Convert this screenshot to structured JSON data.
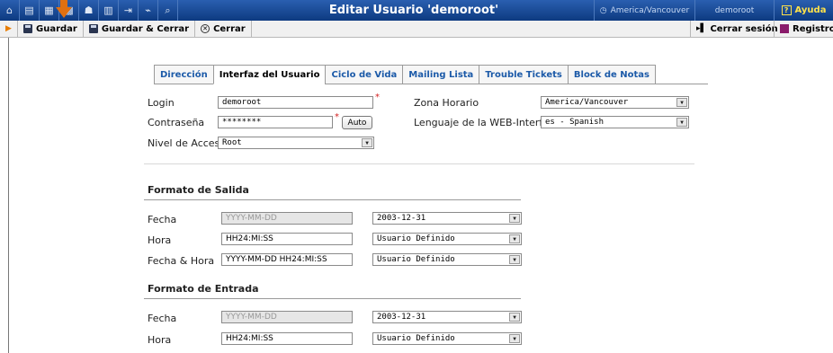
{
  "header": {
    "title": "Editar Usuario 'demoroot'",
    "timezone": "America/Vancouver",
    "user": "demoroot",
    "help_label": "Ayuda",
    "accent_color": "#0d3a80",
    "icons": [
      "home-icon",
      "menu-icon",
      "grid-icon",
      "modules-icon",
      "person-icon",
      "columns-icon",
      "export-icon",
      "chart-icon",
      "search-icon"
    ]
  },
  "toolbar": {
    "save": "Guardar",
    "save_close": "Guardar & Cerrar",
    "close": "Cerrar",
    "logout": "Cerrar sesión",
    "register": "Registro"
  },
  "tabs": [
    {
      "label": "Dirección",
      "active": false
    },
    {
      "label": "Interfaz del Usuario",
      "active": true
    },
    {
      "label": "Ciclo de Vida",
      "active": false
    },
    {
      "label": "Mailing Lista",
      "active": false
    },
    {
      "label": "Trouble Tickets",
      "active": false
    },
    {
      "label": "Block de Notas",
      "active": false
    }
  ],
  "form": {
    "login_label": "Login",
    "login_value": "demoroot",
    "password_label": "Contraseña",
    "password_value": "********",
    "auto_button": "Auto",
    "access_label": "Nivel de Acceso",
    "access_value": "Root",
    "timezone_label": "Zona Horario",
    "timezone_value": "America/Vancouver",
    "language_label": "Lenguaje de la WEB-Interface",
    "language_value": "es - Spanish",
    "required_mark": "*"
  },
  "output_format": {
    "title": "Formato de Salida",
    "rows": [
      {
        "label": "Fecha",
        "value": "YYYY-MM-DD",
        "disabled": true,
        "select": "2003-12-31"
      },
      {
        "label": "Hora",
        "value": "HH24:MI:SS",
        "disabled": false,
        "select": "Usuario Definido"
      },
      {
        "label": "Fecha & Hora",
        "value": "YYYY-MM-DD HH24:MI:SS",
        "disabled": false,
        "select": "Usuario Definido"
      }
    ]
  },
  "input_format": {
    "title": "Formato de Entrada",
    "rows": [
      {
        "label": "Fecha",
        "value": "YYYY-MM-DD",
        "disabled": true,
        "select": "2003-12-31"
      },
      {
        "label": "Hora",
        "value": "HH24:MI:SS",
        "disabled": false,
        "select": "Usuario Definido"
      }
    ]
  }
}
